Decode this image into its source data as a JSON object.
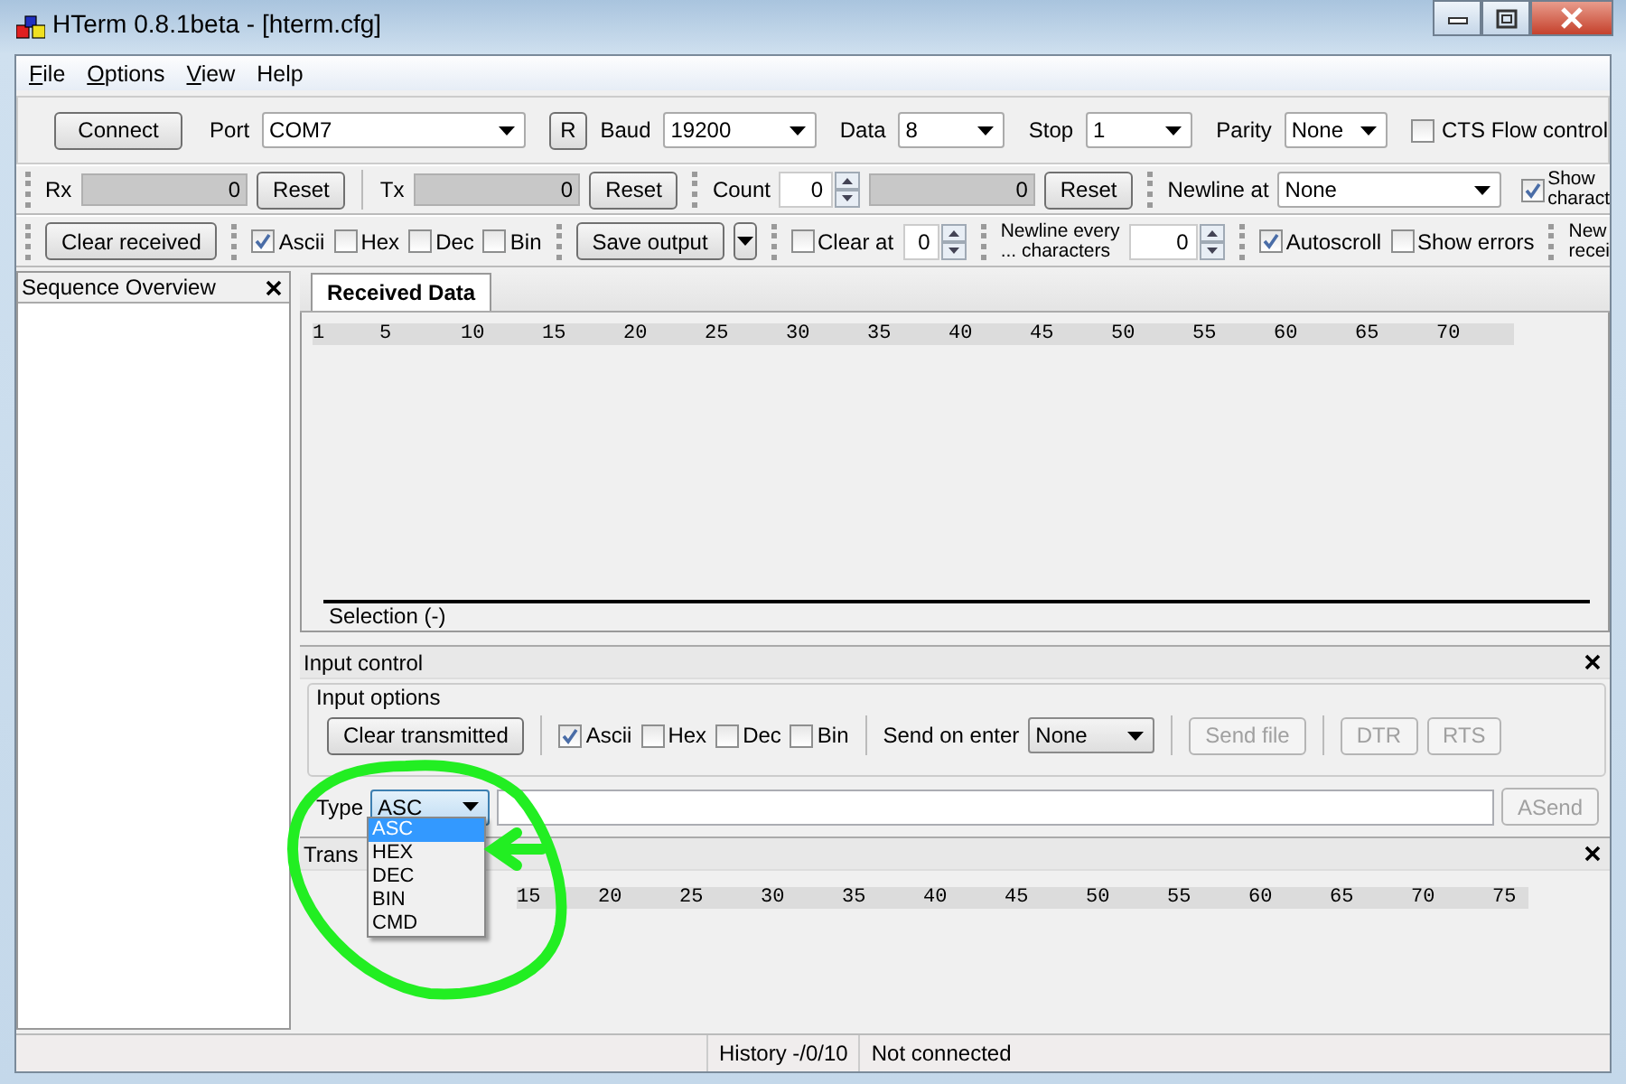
{
  "window": {
    "title": "HTerm 0.8.1beta - [hterm.cfg]"
  },
  "menu": [
    {
      "label": "File",
      "underlined": true
    },
    {
      "label": "Options",
      "underlined": true
    },
    {
      "label": "View",
      "underlined": true
    },
    {
      "label": "Help",
      "underlined": false
    }
  ],
  "connection": {
    "connect_button": "Connect",
    "items": [
      {
        "kind": "select",
        "label": "Port",
        "value": "COM7"
      },
      {
        "kind": "button",
        "label": "R"
      },
      {
        "kind": "select",
        "label": "Baud",
        "value": "19200"
      },
      {
        "kind": "select",
        "label": "Data",
        "value": "8"
      },
      {
        "kind": "select",
        "label": "Stop",
        "value": "1"
      },
      {
        "kind": "select",
        "label": "Parity",
        "value": "None"
      },
      {
        "kind": "checkbox",
        "label": "CTS Flow control",
        "checked": false
      }
    ]
  },
  "counters": {
    "rx": {
      "label": "Rx",
      "value": "0",
      "button": "Reset"
    },
    "tx": {
      "label": "Tx",
      "value": "0",
      "button": "Reset"
    },
    "count": {
      "label": "Count",
      "value": "0",
      "total": "0",
      "button": "Reset"
    },
    "newline_at": {
      "label": "Newline at",
      "value": "None"
    },
    "show_newline": {
      "lines": [
        "Show",
        "charact"
      ],
      "checked": true
    }
  },
  "display": {
    "clear_received": "Clear received",
    "formats": [
      {
        "label": "Ascii",
        "checked": true
      },
      {
        "label": "Hex",
        "checked": false
      },
      {
        "label": "Dec",
        "checked": false
      },
      {
        "label": "Bin",
        "checked": false
      }
    ],
    "save_output": "Save output",
    "clear_at": {
      "label": "Clear at",
      "checked": false,
      "value": "0"
    },
    "newline_every": {
      "lines": [
        "Newline every",
        "... characters"
      ],
      "value": "0"
    },
    "options": [
      {
        "label": "Autoscroll",
        "checked": true
      },
      {
        "label": "Show errors",
        "checked": false
      }
    ],
    "cut_item": [
      "New",
      "recei"
    ]
  },
  "sequence_panel": {
    "title": "Sequence Overview"
  },
  "received": {
    "tabs": [
      {
        "label": "Received Data",
        "selected": true
      }
    ],
    "ruler": [
      "1",
      "5",
      "10",
      "15",
      "20",
      "25",
      "30",
      "35",
      "40",
      "45",
      "50",
      "55",
      "60",
      "65",
      "70"
    ],
    "selection": "Selection (-)"
  },
  "input_control": {
    "title": "Input control",
    "group": "Input options",
    "clear_transmitted": "Clear transmitted",
    "formats": [
      {
        "label": "Ascii",
        "checked": true
      },
      {
        "label": "Hex",
        "checked": false
      },
      {
        "label": "Dec",
        "checked": false
      },
      {
        "label": "Bin",
        "checked": false
      }
    ],
    "send_on_enter": {
      "label": "Send on enter",
      "value": "None"
    },
    "buttons": [
      {
        "label": "Send file",
        "disabled": true
      },
      {
        "label": "DTR",
        "disabled": true
      },
      {
        "label": "RTS",
        "disabled": true
      }
    ],
    "type": {
      "label": "Type",
      "value": "ASC"
    },
    "asend": {
      "label": "ASend",
      "disabled": true
    },
    "type_options": [
      {
        "label": "ASC",
        "selected": true
      },
      {
        "label": "HEX",
        "selected": false
      },
      {
        "label": "DEC",
        "selected": false
      },
      {
        "label": "BIN",
        "selected": false
      },
      {
        "label": "CMD",
        "selected": false
      }
    ]
  },
  "transmitted": {
    "title": "Trans",
    "ruler": [
      "15",
      "20",
      "25",
      "30",
      "35",
      "40",
      "45",
      "50",
      "55",
      "60",
      "65",
      "70",
      "75"
    ]
  },
  "status_bar": {
    "history": "History -/0/10",
    "connection": "Not connected"
  }
}
